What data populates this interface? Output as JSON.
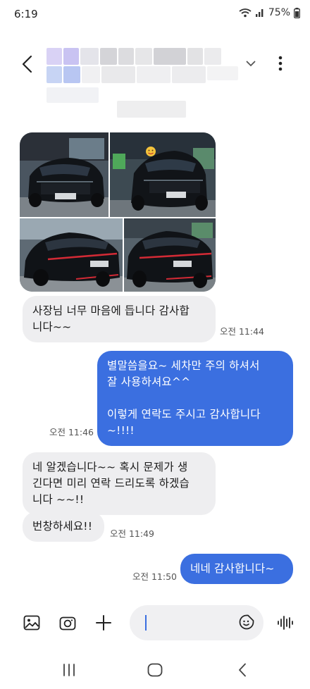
{
  "status_bar": {
    "time": "6:19",
    "battery": "75%"
  },
  "header": {
    "back_icon": "chevron-left-icon",
    "expand_icon": "chevron-down-icon",
    "menu_icon": "more-vertical-icon"
  },
  "photos": [
    {
      "name": "photo-front-left"
    },
    {
      "name": "photo-front-right"
    },
    {
      "name": "photo-rear-left"
    },
    {
      "name": "photo-rear-right"
    }
  ],
  "messages": [
    {
      "id": "m1",
      "direction": "in",
      "text": "사장님 너무 마음에 듭니다 감사합\n니다~~",
      "time": "오전 11:44"
    },
    {
      "id": "m2",
      "direction": "out",
      "text": "별말씀을요~ 세차만 주의 하셔서\n잘 사용하셔요^^\n\n이렇게 연락도 주시고 감사합니다\n~!!!!",
      "time": "오전 11:46"
    },
    {
      "id": "m3",
      "direction": "in",
      "text": "네 알겠습니다~~ 혹시 문제가 생\n긴다면 미리 연락 드리도록 하겠습\n니다 ~~!!",
      "time": ""
    },
    {
      "id": "m4",
      "direction": "in",
      "text": "번창하세요!!",
      "time": "오전 11:49"
    },
    {
      "id": "m5",
      "direction": "out",
      "text": "네네 감사합니다~",
      "time": "오전 11:50"
    }
  ],
  "composer": {
    "gallery_icon": "image-icon",
    "camera_icon": "camera-icon",
    "add_icon": "plus-icon",
    "input_value": "",
    "sticker_icon": "sticker-icon",
    "voice_icon": "voice-wave-icon"
  },
  "nav": {
    "recents_icon": "recents-icon",
    "home_icon": "home-icon",
    "back_icon": "nav-back-icon"
  },
  "colors": {
    "outgoing_bubble": "#3b6fe0",
    "incoming_bubble": "#eeeef0",
    "background": "#ffffff"
  }
}
